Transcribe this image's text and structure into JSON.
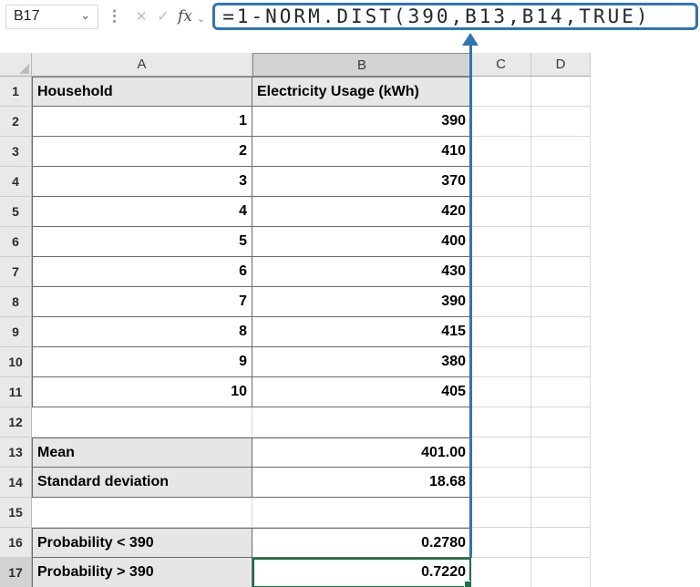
{
  "formula_bar": {
    "name_box": "B17",
    "formula": "=1-NORM.DIST(390,B13,B14,TRUE)"
  },
  "icons": {
    "chevron_down": "⌄",
    "dots_separator": "⋮",
    "cancel": "✕",
    "enter": "✓",
    "fx": "fx"
  },
  "selection": {
    "cell": "B17",
    "column": "B",
    "row": 17
  },
  "grid": {
    "columns": [
      {
        "letter": "A"
      },
      {
        "letter": "B"
      },
      {
        "letter": "C"
      },
      {
        "letter": "D"
      }
    ],
    "rows": [
      {
        "n": 1,
        "kind": "header",
        "a": "Household",
        "b": "Electricity Usage (kWh)"
      },
      {
        "n": 2,
        "kind": "data",
        "a": "1",
        "b": "390"
      },
      {
        "n": 3,
        "kind": "data",
        "a": "2",
        "b": "410"
      },
      {
        "n": 4,
        "kind": "data",
        "a": "3",
        "b": "370"
      },
      {
        "n": 5,
        "kind": "data",
        "a": "4",
        "b": "420"
      },
      {
        "n": 6,
        "kind": "data",
        "a": "5",
        "b": "400"
      },
      {
        "n": 7,
        "kind": "data",
        "a": "6",
        "b": "430"
      },
      {
        "n": 8,
        "kind": "data",
        "a": "7",
        "b": "390"
      },
      {
        "n": 9,
        "kind": "data",
        "a": "8",
        "b": "415"
      },
      {
        "n": 10,
        "kind": "data",
        "a": "9",
        "b": "380"
      },
      {
        "n": 11,
        "kind": "data",
        "a": "10",
        "b": "405"
      },
      {
        "n": 12,
        "kind": "blank",
        "a": "",
        "b": ""
      },
      {
        "n": 13,
        "kind": "stat",
        "a": "Mean",
        "b": "401.00"
      },
      {
        "n": 14,
        "kind": "stat",
        "a": "Standard deviation",
        "b": "18.68"
      },
      {
        "n": 15,
        "kind": "blank",
        "a": "",
        "b": ""
      },
      {
        "n": 16,
        "kind": "stat",
        "a": "Probability < 390",
        "b": "0.2780"
      },
      {
        "n": 17,
        "kind": "stat",
        "a": "Probability > 390",
        "b": "0.7220"
      }
    ]
  },
  "colors": {
    "accent_blue": "#2E75B6",
    "selection_green": "#1A7240",
    "header_bg": "#E9E9E9",
    "header_selected_bg": "#D2D2D2",
    "label_bg": "#E7E6E6",
    "table_border": "#6B6B6B",
    "gridline": "#D9D9D9"
  }
}
